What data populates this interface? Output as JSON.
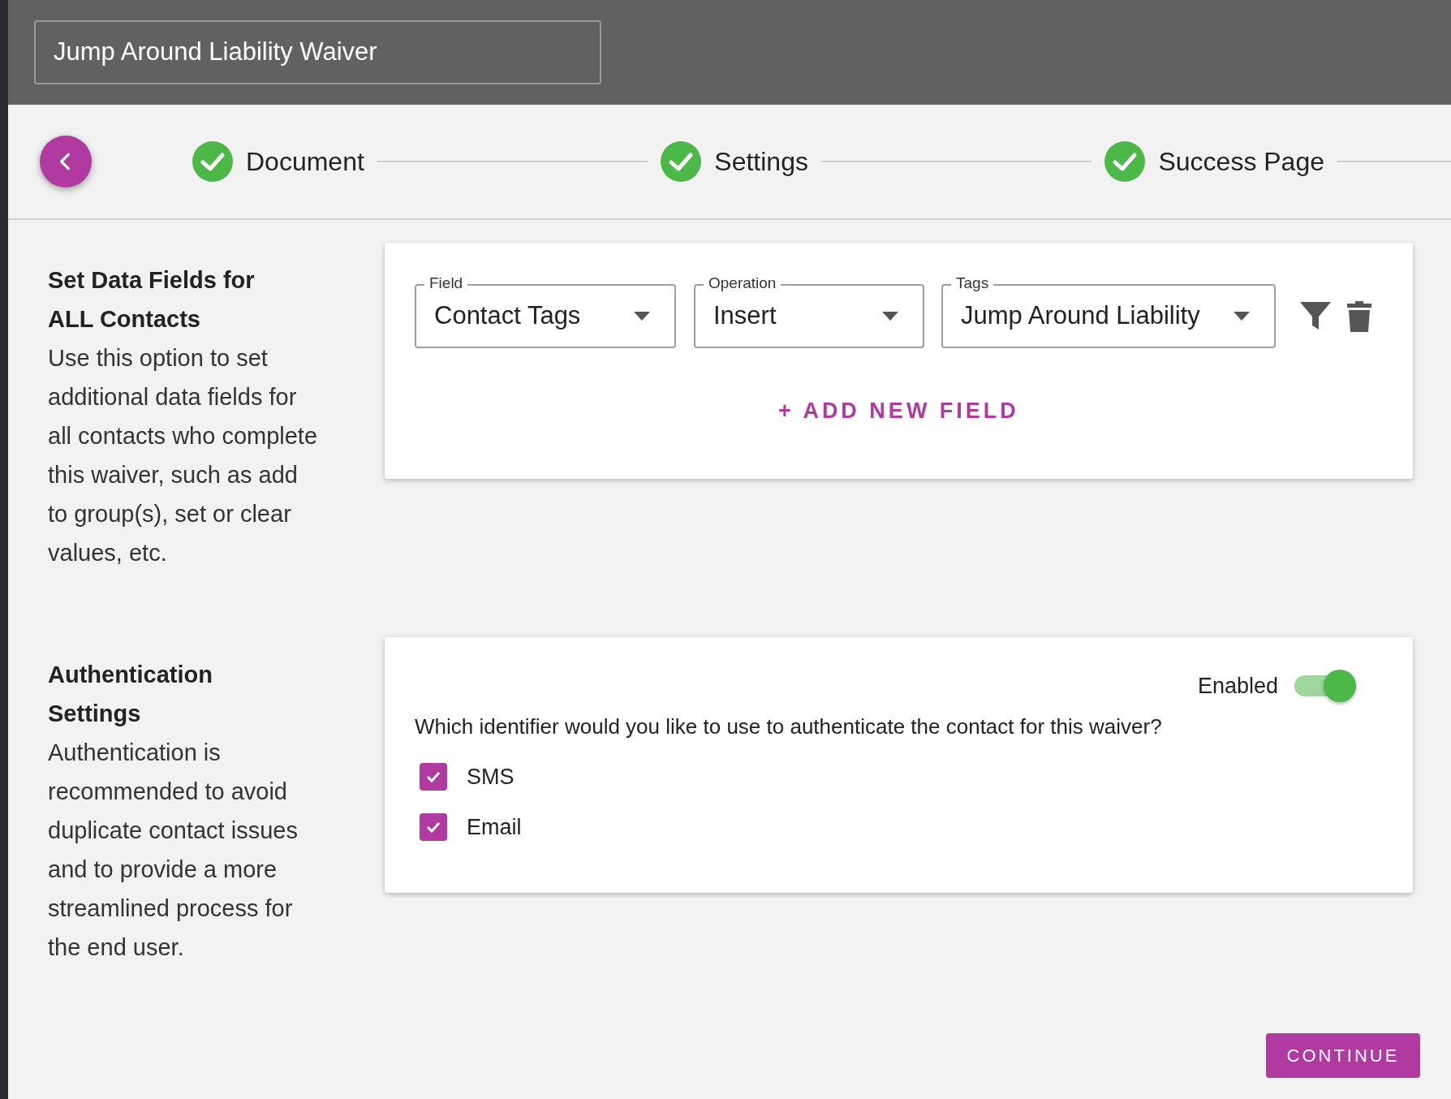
{
  "title_field": {
    "value": "Jump Around Liability Waiver"
  },
  "stepper": {
    "steps": [
      {
        "label": "Document",
        "completed": true
      },
      {
        "label": "Settings",
        "completed": true
      },
      {
        "label": "Success Page",
        "completed": true
      }
    ]
  },
  "sections": [
    {
      "kind": "data_fields",
      "heading": "Set Data Fields for ALL Contacts",
      "description": "Use this option to set additional data fields for all contacts who complete this waiver, such as add to group(s), set or clear values, etc.",
      "fields": [
        {
          "label": "Field",
          "value": "Contact Tags"
        },
        {
          "label": "Operation",
          "value": "Insert"
        },
        {
          "label": "Tags",
          "value": "Jump Around Liability"
        }
      ],
      "add_button": "+ ADD NEW FIELD"
    },
    {
      "kind": "authentication",
      "heading": "Authentication Settings",
      "description": "Authentication is recommended to avoid duplicate contact issues and to provide a more streamlined process for the end user.",
      "toggle": {
        "label": "Enabled",
        "on": true
      },
      "question": "Which identifier would you like to use to authenticate the contact for this waiver?",
      "options": [
        {
          "label": "SMS",
          "checked": true
        },
        {
          "label": "Email",
          "checked": true
        }
      ]
    }
  ],
  "continue_button": "CONTINUE"
}
